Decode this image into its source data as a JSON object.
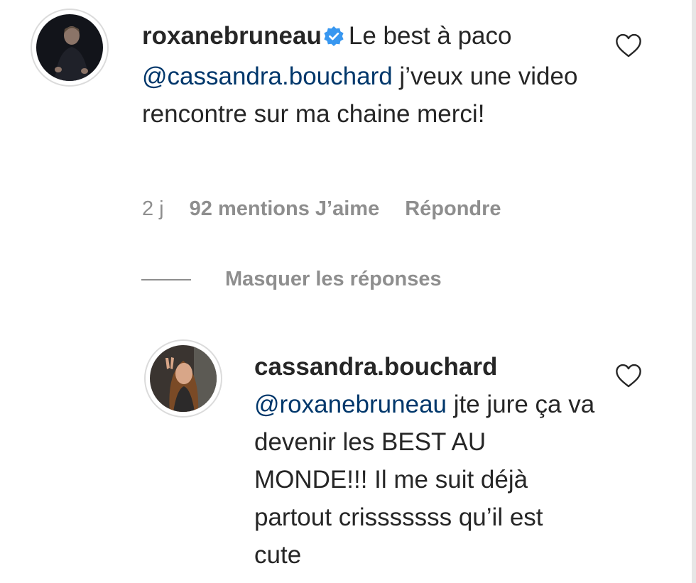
{
  "comment": {
    "username": "roxanebruneau",
    "text_before_mention": "Le best à paco",
    "mention": "@cassandra.bouchard",
    "text_after_mention": "j’veux une video rencontre sur ma chaine merci!",
    "time": "2 j",
    "likes": "92 mentions J’aime",
    "reply_label": "Répondre"
  },
  "replies_toggle": "Masquer les réponses",
  "reply": {
    "username": "cassandra.bouchard",
    "mention": "@roxanebruneau",
    "text": "jte jure ça va devenir les BEST AU MONDE!!! Il me suit déjà partout crisssssss qu’il est cute"
  },
  "icons": {
    "verified": "verified-badge-icon",
    "like": "heart-icon"
  },
  "colors": {
    "text": "#262626",
    "secondary": "#8e8e8e",
    "mention": "#00376b",
    "verified": "#3897f0"
  }
}
